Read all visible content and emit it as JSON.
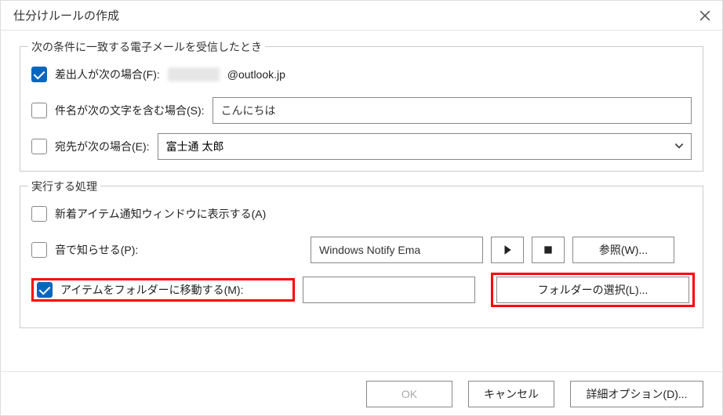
{
  "dialog": {
    "title": "仕分けルールの作成",
    "ok": "OK",
    "cancel": "キャンセル",
    "advanced": "詳細オプション(D)..."
  },
  "conditions": {
    "group": "次の条件に一致する電子メールを受信したとき",
    "from_label": "差出人が次の場合(F):",
    "from_domain": "@outlook.jp",
    "subject_label": "件名が次の文字を含む場合(S):",
    "subject_value": "こんにちは",
    "to_label": "宛先が次の場合(E):",
    "to_value": "富士通 太郎"
  },
  "actions": {
    "group": "実行する処理",
    "alert_label": "新着アイテム通知ウィンドウに表示する(A)",
    "sound_label": "音で知らせる(P):",
    "sound_value": "Windows Notify Ema",
    "browse": "参照(W)...",
    "move_label": "アイテムをフォルダーに移動する(M):",
    "folder_select": "フォルダーの選択(L)..."
  }
}
